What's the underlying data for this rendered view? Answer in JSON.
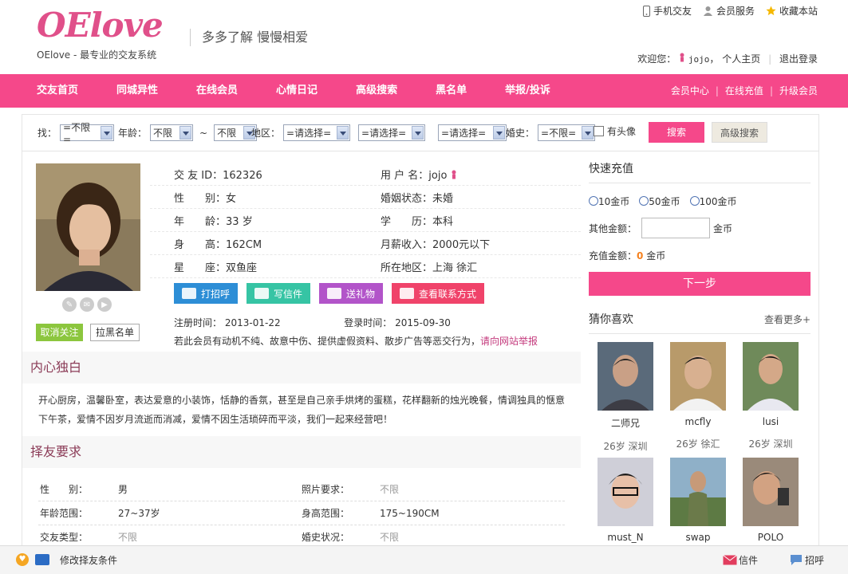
{
  "site": {
    "logo": "OElove",
    "tagline": "OElove - 最专业的交友系统",
    "slogan": "多多了解 慢慢相爱"
  },
  "toplinks": [
    "手机交友",
    "会员服务",
    "收藏本站"
  ],
  "welcome": {
    "prefix": "欢迎您：",
    "user": "jojo",
    "comma": "，",
    "home": "个人主页",
    "logout": "退出登录"
  },
  "nav": {
    "items": [
      "交友首页",
      "同城异性",
      "在线会员",
      "心情日记",
      "高级搜索",
      "黑名单",
      "举报/投诉"
    ],
    "right": [
      "会员中心",
      "在线充值",
      "升级会员"
    ]
  },
  "filter": {
    "find_label": "找：",
    "find_value": "=不限=",
    "age_label": "年龄：",
    "age_from": "不限",
    "tilde": "~",
    "age_to": "不限",
    "area_label": "地区：",
    "area1": "=请选择=",
    "area2": "=请选择=",
    "area3": "=请选择=",
    "marriage_label": "婚史：",
    "marriage_value": "=不限=",
    "photo_label": "有头像",
    "search_button": "搜索",
    "advanced_button": "高级搜索"
  },
  "profile": {
    "rows": [
      [
        {
          "k": "交 友 ID：",
          "v": "162326"
        },
        {
          "k": "用 户 名：",
          "v": "jojo"
        }
      ],
      [
        {
          "k": "性　　别：",
          "v": "女"
        },
        {
          "k": "婚姻状态：",
          "v": "未婚"
        }
      ],
      [
        {
          "k": "年　　龄：",
          "v": "33 岁"
        },
        {
          "k": "学　　历：",
          "v": "本科"
        }
      ],
      [
        {
          "k": "身　　高：",
          "v": "162CM"
        },
        {
          "k": "月薪收入：",
          "v": "2000元以下"
        }
      ],
      [
        {
          "k": "星　　座：",
          "v": "双鱼座"
        },
        {
          "k": "所在地区：",
          "v": "上海 徐汇"
        }
      ]
    ],
    "actions": [
      {
        "label": "打招呼",
        "color": "#2d8ed6"
      },
      {
        "label": "写信件",
        "color": "#36c4a4"
      },
      {
        "label": "送礼物",
        "color": "#b254c9"
      },
      {
        "label": "查看联系方式",
        "color": "#f0436a"
      }
    ],
    "reg_label": "注册时间：",
    "reg_date": "2013-01-22",
    "login_label": "登录时间：",
    "login_date": "2015-09-30",
    "report_text": "若此会员有动机不纯、故意中伤、提供虚假资料、散步广告等恶交行为，",
    "report_link": "请向网站举报",
    "unfollow_button": "取消关注",
    "blacklist_button": "拉黑名单"
  },
  "monologue": {
    "title": "内心独白",
    "text": "开心厨房，温馨卧室，表达爱意的小装饰，恬静的香氛，甚至是自己亲手烘烤的蛋糕，花样翻新的烛光晚餐，情调独具的惬意下午茶，爱情不因岁月流逝而消减，爱情不因生活琐碎而平淡，我们一起来经营吧！"
  },
  "requirements": {
    "title": "择友要求",
    "rows": [
      [
        {
          "k": "性　　别：",
          "v": "男",
          "gray": false
        },
        {
          "k": "照片要求：",
          "v": "不限",
          "gray": true
        }
      ],
      [
        {
          "k": "年龄范围：",
          "v": "27~37岁",
          "gray": false
        },
        {
          "k": "身高范围：",
          "v": "175~190CM",
          "gray": false
        }
      ],
      [
        {
          "k": "交友类型：",
          "v": "不限",
          "gray": true
        },
        {
          "k": "婚史状况：",
          "v": "不限",
          "gray": true
        }
      ]
    ]
  },
  "recharge": {
    "title": "快速充值",
    "options": [
      "10金币",
      "50金币",
      "100金币"
    ],
    "other_label": "其他金额：",
    "unit": "金币",
    "amount_label": "充值金额：",
    "amount_value": "0",
    "amount_unit": "金币",
    "next_button": "下一步"
  },
  "guess": {
    "title": "猜你喜欢",
    "more": "查看更多+",
    "people": [
      {
        "name": "二师兄",
        "meta": "26岁 深圳"
      },
      {
        "name": "mcfly",
        "meta": "26岁 徐汇"
      },
      {
        "name": "lusi",
        "meta": "26岁 深圳"
      },
      {
        "name": "must_N",
        "meta": ""
      },
      {
        "name": "swap",
        "meta": ""
      },
      {
        "name": "POLO",
        "meta": ""
      }
    ]
  },
  "bottombar": {
    "edit_label": "修改择友条件",
    "mail_label": "信件",
    "greet_label": "招呼"
  }
}
